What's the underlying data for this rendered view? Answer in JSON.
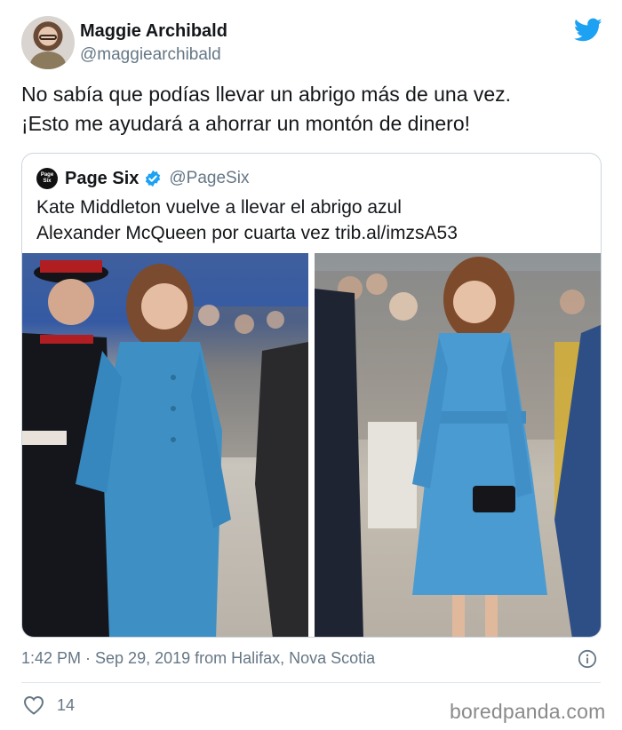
{
  "author": {
    "name": "Maggie Archibald",
    "handle": "@maggiearchibald"
  },
  "tweet": {
    "line1": "No sabía que podías llevar un abrigo más de una vez.",
    "line2": "¡Esto me ayudará a ahorrar un montón de dinero!"
  },
  "quoted_tweet": {
    "name": "Page Six",
    "handle": "@PageSix",
    "logo_text_top": "Page",
    "logo_text_bottom": "Six",
    "line1": "Kate Middleton vuelve a llevar el abrigo azul",
    "line2": "Alexander McQueen por cuarta vez trib.al/imzsA53"
  },
  "meta": {
    "timestamp": "1:42 PM · Sep 29, 2019 from Halifax, Nova Scotia",
    "likes": "14"
  },
  "watermark": "boredpanda.com",
  "colors": {
    "twitter_blue": "#1da1f2",
    "coat_blue": "#3d8fc4",
    "text": "#14171a",
    "muted": "#657786"
  },
  "icons": [
    "twitter-icon",
    "verified-icon",
    "info-icon",
    "heart-icon"
  ]
}
